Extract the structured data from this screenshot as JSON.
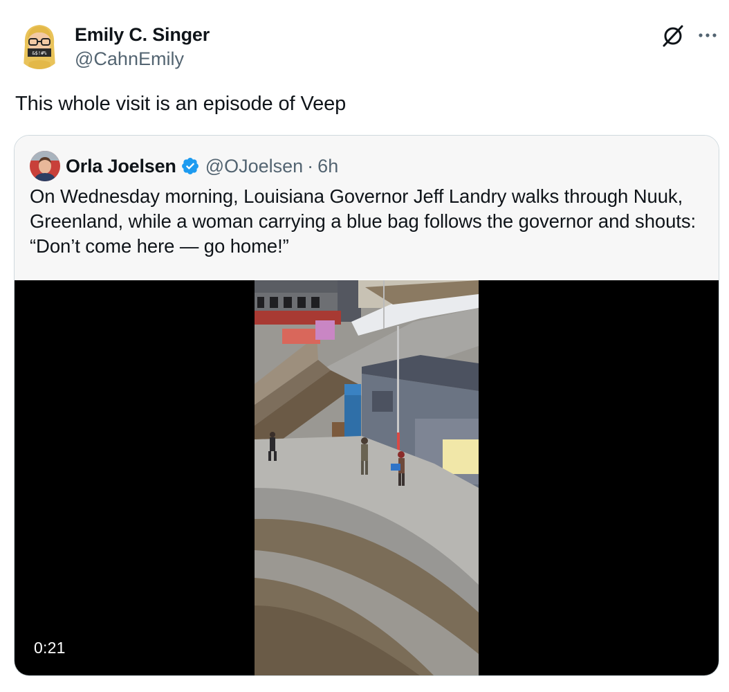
{
  "author": {
    "display_name": "Emily C. Singer",
    "handle": "@CahnEmily",
    "avatar_icon": "memoji-avatar-icon"
  },
  "header_icons": [
    "grok-icon",
    "more-icon"
  ],
  "tweet": {
    "text": "This whole visit is an episode of Veep"
  },
  "quoted_tweet": {
    "display_name": "Orla Joelsen",
    "verified": true,
    "verified_color": "#1d9bf0",
    "handle": "@OJoelsen",
    "separator": "·",
    "time": "6h",
    "text": "On Wednesday morning, Louisiana Governor Jeff Landry walks through Nuuk, Greenland, while a woman carrying a blue bag follows the governor and shouts: “Don’t come here — go home!”",
    "video": {
      "duration": "0:21"
    }
  }
}
